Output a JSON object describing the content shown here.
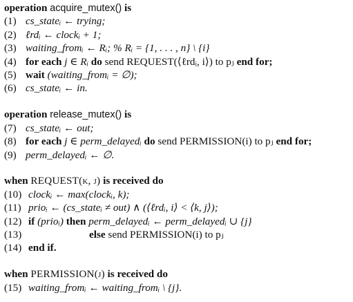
{
  "acquire": {
    "header": {
      "kw1": "operation",
      "name": "acquire_mutex()",
      "kw2": "is"
    },
    "lines": [
      {
        "num": "(1)",
        "text": "cs_stateᵢ ← trying;"
      },
      {
        "num": "(2)",
        "text": "ℓrdᵢ ← clockᵢ + 1;"
      },
      {
        "num": "(3)",
        "text": "waiting_fromᵢ ← Rᵢ;   % Rᵢ = {1, . . . , n} \\ {i}"
      },
      {
        "num": "(4)",
        "kw1": "for each",
        "mid1": "j ∈ Rᵢ",
        "kw2": "do",
        "mid2": "send REQUEST(⟨ℓrdᵢ, i⟩) to pⱼ",
        "kw3": "end for;"
      },
      {
        "num": "(5)",
        "kw1": "wait",
        "mid1": "(waiting_fromᵢ = ∅);"
      },
      {
        "num": "(6)",
        "text": "cs_stateᵢ ← in."
      }
    ]
  },
  "release": {
    "header": {
      "kw1": "operation",
      "name": "release_mutex()",
      "kw2": "is"
    },
    "lines": [
      {
        "num": "(7)",
        "text": "cs_stateᵢ ← out;"
      },
      {
        "num": "(8)",
        "kw1": "for each",
        "mid1": "j ∈ perm_delayedᵢ",
        "kw2": "do",
        "mid2": "send PERMISSION(i) to pⱼ",
        "kw3": "end for;"
      },
      {
        "num": "(9)",
        "text": "perm_delayedᵢ ← ∅."
      }
    ]
  },
  "request": {
    "header": {
      "kw1": "when",
      "msg": "REQUEST(k, j)",
      "kw2": "is received do"
    },
    "lines": [
      {
        "num": "(10)",
        "text": "clockᵢ ← max(clockᵢ, k);"
      },
      {
        "num": "(11)",
        "text": "prioᵢ ← (cs_stateᵢ ≠ out) ∧ (⟨ℓrdᵢ, i⟩ < ⟨k, j⟩);"
      },
      {
        "num": "(12)",
        "kw1": "if",
        "mid1": "(prioᵢ)",
        "kw2": "then",
        "mid2": "perm_delayedᵢ ← perm_delayedᵢ ∪ {j}"
      },
      {
        "num": "(13)",
        "kw1": "else",
        "mid1": "send PERMISSION(i) to pⱼ"
      },
      {
        "num": "(14)",
        "kw1": "end if."
      }
    ]
  },
  "permission": {
    "header": {
      "kw1": "when",
      "msg": "PERMISSION(j)",
      "kw2": "is received do"
    },
    "lines": [
      {
        "num": "(15)",
        "text": "waiting_fromᵢ ← waiting_fromᵢ \\ {j}."
      }
    ]
  }
}
